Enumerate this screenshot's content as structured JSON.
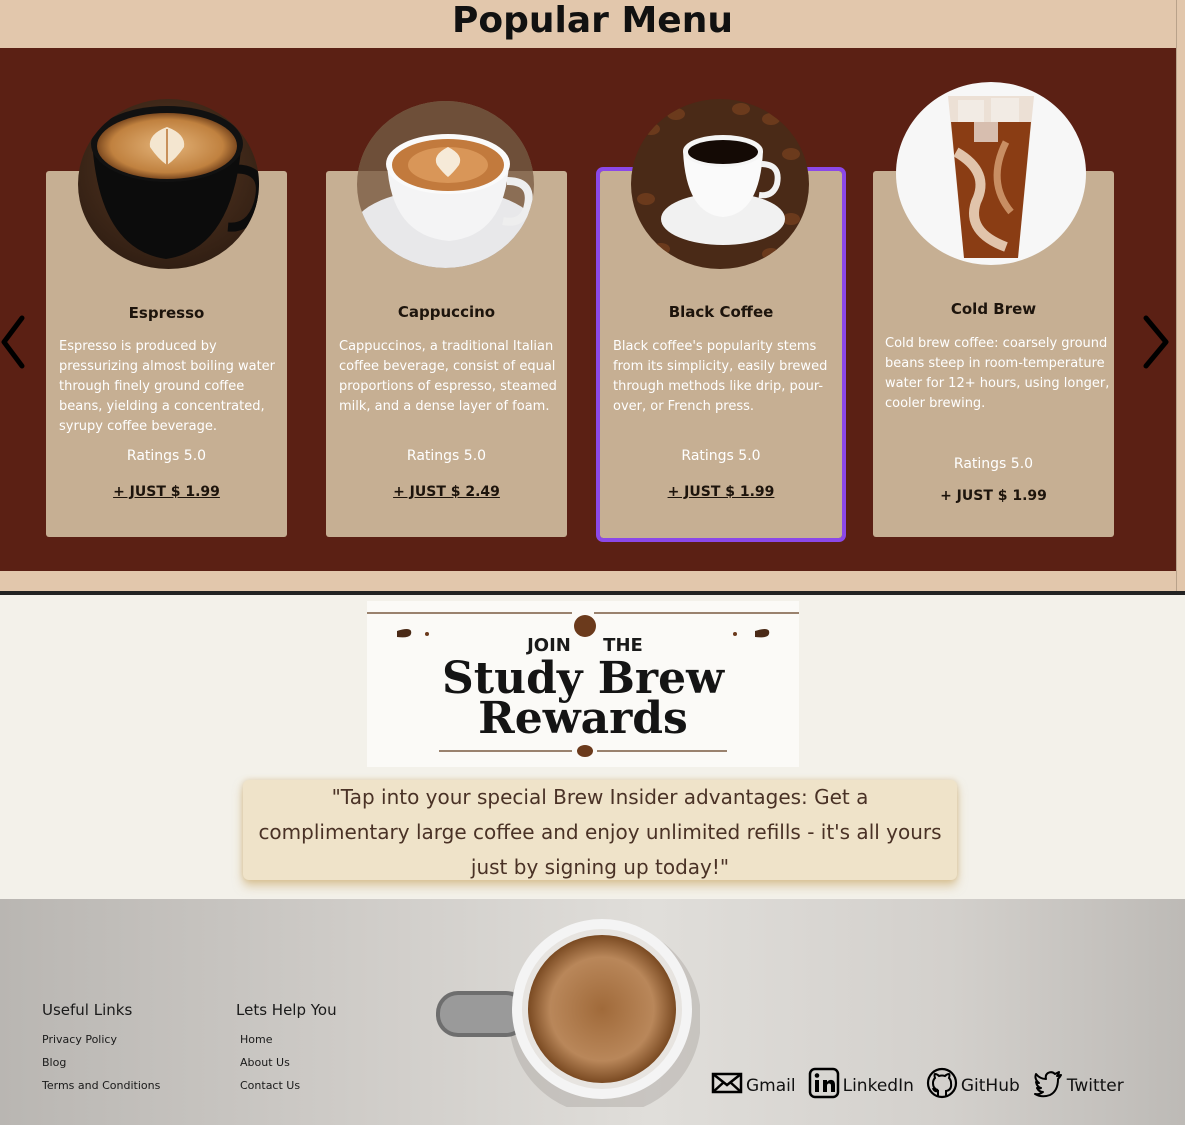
{
  "menu": {
    "title": "Popular Menu",
    "items": [
      {
        "name": "Espresso",
        "description": "Espresso is produced by pressurizing almost boiling water through finely ground coffee beans, yielding a concentrated, syrupy coffee beverage.",
        "rating": "Ratings 5.0",
        "price": "+ JUST $ 1.99"
      },
      {
        "name": "Cappuccino",
        "description": "Cappuccinos, a traditional Italian coffee beverage, consist of equal proportions of espresso, steamed milk, and a dense layer of foam.",
        "rating": "Ratings 5.0",
        "price": "+ JUST $ 2.49"
      },
      {
        "name": "Black Coffee",
        "description": "Black coffee's popularity stems from its simplicity, easily brewed through methods like drip, pour-over, or French press.",
        "rating": "Ratings 5.0",
        "price": "+ JUST $ 1.99"
      },
      {
        "name": "Cold Brew",
        "description": "Cold brew coffee: coarsely ground beans steep in room-temperature water for 12+ hours, using longer, cooler brewing.",
        "rating": "Ratings 5.0",
        "price": "+ JUST $ 1.99"
      }
    ],
    "prev_icon": "chevron-left-icon",
    "next_icon": "chevron-right-icon",
    "selected_index": 2
  },
  "rewards": {
    "banner_join": "JOIN",
    "banner_the": "THE",
    "banner_line1": "Study Brew",
    "banner_line2": "Rewards",
    "quote": "\"Tap into your special Brew Insider advantages: Get a complimentary large coffee and enjoy unlimited refills - it's all yours just by signing up today!\""
  },
  "footer": {
    "useful_links": {
      "heading": "Useful Links",
      "links": [
        "Privacy Policy",
        "Blog",
        "Terms and Conditions"
      ]
    },
    "help": {
      "heading": "Lets Help You",
      "links": [
        "Home",
        "About Us",
        "Contact Us"
      ]
    },
    "socials": [
      {
        "label": "Gmail",
        "icon": "mail-icon"
      },
      {
        "label": "LinkedIn",
        "icon": "linkedin-icon"
      },
      {
        "label": "GitHub",
        "icon": "github-icon"
      },
      {
        "label": "Twitter",
        "icon": "twitter-icon"
      }
    ]
  },
  "colors": {
    "band": "#5b2014",
    "card": "#c6af93",
    "page_bg": "#e2c7ac",
    "selected_outline": "#8b48e8"
  }
}
